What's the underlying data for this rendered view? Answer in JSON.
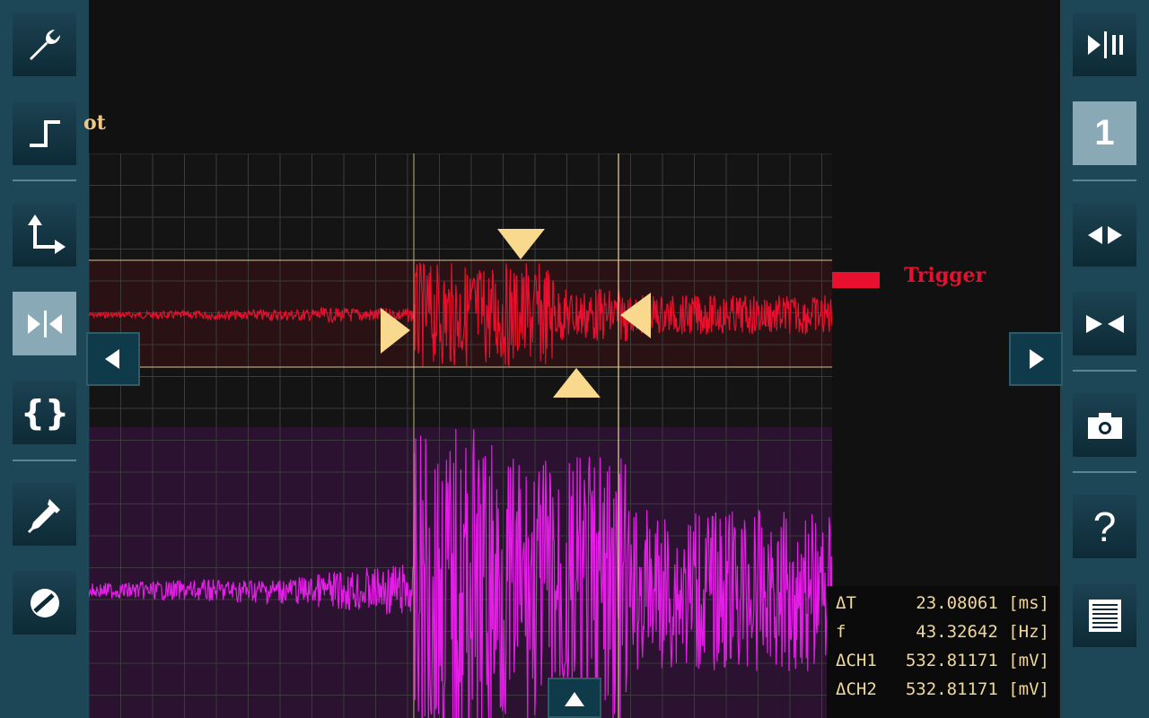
{
  "left_toolbar": {
    "tools": [
      {
        "icon": "wrench-icon",
        "active": false
      },
      {
        "icon": "step-edge-icon",
        "active": false
      },
      {
        "icon": "axes-arrows-icon",
        "active": false
      },
      {
        "icon": "cursors-toggle-icon",
        "active": true
      },
      {
        "icon": "braces-icon",
        "active": false
      },
      {
        "icon": "probe-icon",
        "active": false
      },
      {
        "icon": "slash-circle-icon",
        "active": false
      }
    ]
  },
  "right_toolbar": {
    "channel_number": "1",
    "tools": [
      "play-pause-icon",
      "channel-select-icon",
      "expand-horizontal-icon",
      "shrink-horizontal-icon",
      "camera-icon",
      "help-icon",
      "menu-list-icon"
    ]
  },
  "header": {
    "partial_label": "ot"
  },
  "trigger": {
    "label": "Trigger",
    "color": "#e8102e"
  },
  "measurements": [
    {
      "label": "ΔT",
      "value": "23.08061 [ms]"
    },
    {
      "label": "f",
      "value": "43.32642 [Hz]"
    },
    {
      "label": "ΔCH1",
      "value": "532.81171 [mV]"
    },
    {
      "label": "ΔCH2",
      "value": "532.81171 [mV]"
    }
  ],
  "colors": {
    "channel1": "#e8102e",
    "channel2": "#e41ee6",
    "cursor": "#f0d79a",
    "accent": "#f9d98e"
  },
  "help_glyph": "?"
}
